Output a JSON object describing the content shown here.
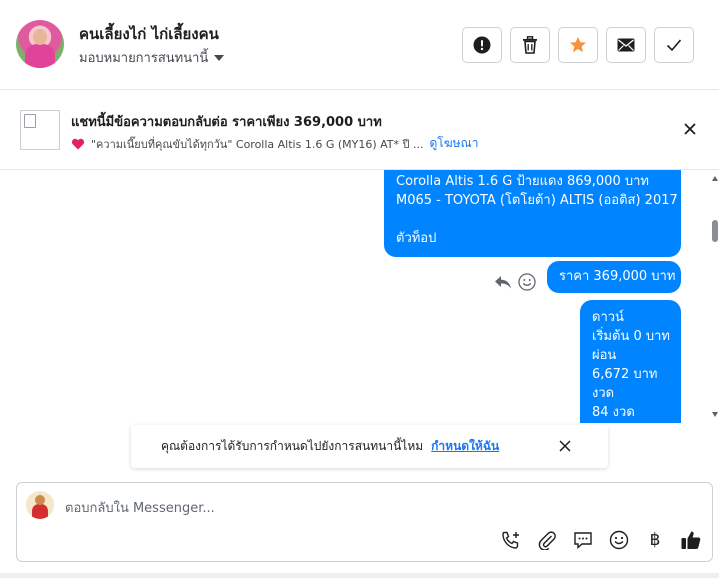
{
  "header": {
    "title": "คนเลี้ยงไก่ ไก่เลี้ยงคน",
    "assign_label": "มอบหมายการสนทนานี้",
    "buttons": [
      "mark-spam",
      "delete",
      "star",
      "mark-unread",
      "mark-done"
    ]
  },
  "ad": {
    "title": "แชทนี้มีข้อความตอบกลับต่อ ราคาเพียง 369,000 บาท",
    "description": "\"ความเนี๊ยบที่คุณขับได้ทุกวัน\"  Corolla Altis 1.6 G (MY16) AT* ปี ...",
    "link_label": "ดูโฆษณา"
  },
  "messages": [
    {
      "lines": [
        "Corolla Altis 1.6 G ป้ายแดง 869,000 บาท",
        "M065 - TOYOTA (โตโยต้า) ALTIS (ออติส) 2017",
        "",
        "ตัวท็อป"
      ]
    },
    {
      "lines": [
        "ราคา 369,000 บาท"
      ]
    },
    {
      "lines": [
        "ดาวน์",
        "เริ่มต้น 0 บาท",
        "ผ่อน",
        "6,672 บาท",
        "งวด",
        "84 งวด"
      ]
    }
  ],
  "assign_prompt": {
    "text": "คุณต้องการได้รับการกำหนดไปยังการสนทนานี้ไหม",
    "link_label": "กำหนดให้ฉัน"
  },
  "composer": {
    "placeholder": "ตอบกลับใน Messenger...",
    "baht_symbol": "฿"
  },
  "colors": {
    "bubble": "#0084ff",
    "link": "#1877f2",
    "star": "#f7923b"
  }
}
